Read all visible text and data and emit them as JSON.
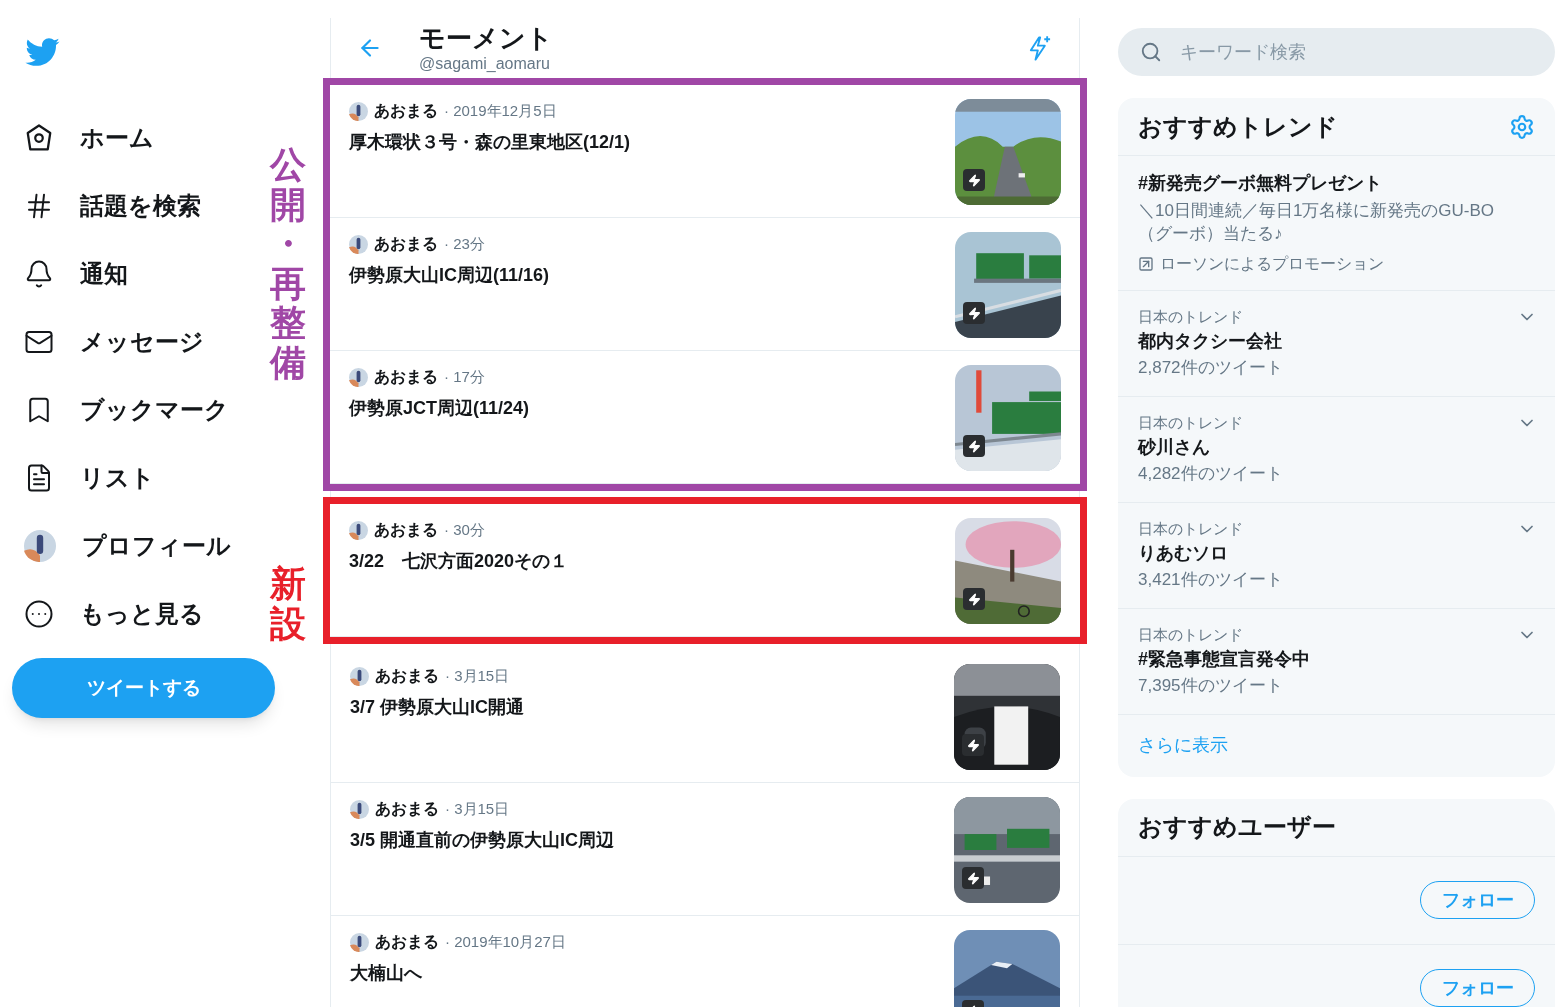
{
  "nav": {
    "items": [
      {
        "kind": "home",
        "label": "ホーム"
      },
      {
        "kind": "hash",
        "label": "話題を検索"
      },
      {
        "kind": "bell",
        "label": "通知"
      },
      {
        "kind": "mail",
        "label": "メッセージ"
      },
      {
        "kind": "bookmark",
        "label": "ブックマーク"
      },
      {
        "kind": "list",
        "label": "リスト"
      },
      {
        "kind": "avatar",
        "label": "プロフィール"
      },
      {
        "kind": "more",
        "label": "もっと見る"
      }
    ],
    "tweet_button": "ツイートする"
  },
  "header": {
    "title": "モーメント",
    "handle": "@sagami_aomaru"
  },
  "moment_groups": [
    {
      "label": "公開・再整備",
      "color": "#a047a6",
      "moments": [
        {
          "author": "あおまる",
          "time": "· 2019年12月5日",
          "title": "厚木環状３号・森の里東地区(12/1)"
        },
        {
          "author": "あおまる",
          "time": "· 23分",
          "title": "伊勢原大山IC周辺(11/16)"
        },
        {
          "author": "あおまる",
          "time": "· 17分",
          "title": "伊勢原JCT周辺(11/24)"
        }
      ]
    },
    {
      "label": "新設",
      "color": "#e8202a",
      "moments": [
        {
          "author": "あおまる",
          "time": "· 30分",
          "title": "3/22　七沢方面2020その１"
        }
      ]
    },
    {
      "moments": [
        {
          "author": "あおまる",
          "time": "· 3月15日",
          "title": "3/7 伊勢原大山IC開通"
        },
        {
          "author": "あおまる",
          "time": "· 3月15日",
          "title": "3/5 開通直前の伊勢原大山IC周辺"
        },
        {
          "author": "あおまる",
          "time": "· 2019年10月27日",
          "title": "大楠山へ"
        }
      ]
    }
  ],
  "search": {
    "placeholder": "キーワード検索"
  },
  "trends": {
    "title": "おすすめトレンド",
    "items": [
      {
        "kind": "promoted",
        "title": "#新発売グーボ無料プレゼント",
        "description": "＼10日間連続／毎日1万名様に新発売のGU-BO（グーボ）当たる♪",
        "promoter": "ローソンによるプロモーション"
      },
      {
        "kind": "trend",
        "context": "日本のトレンド",
        "title": "都内タクシー会社",
        "count": "2,872件のツイート"
      },
      {
        "kind": "trend",
        "context": "日本のトレンド",
        "title": "砂川さん",
        "count": "4,282件のツイート"
      },
      {
        "kind": "trend",
        "context": "日本のトレンド",
        "title": "りあむソロ",
        "count": "3,421件のツイート"
      },
      {
        "kind": "trend",
        "context": "日本のトレンド",
        "title": "#緊急事態宣言発令中",
        "count": "7,395件のツイート"
      }
    ],
    "show_more": "さらに表示"
  },
  "users": {
    "title": "おすすめユーザー",
    "items": [
      {
        "follow": "フォロー"
      },
      {
        "follow": "フォロー"
      }
    ]
  }
}
